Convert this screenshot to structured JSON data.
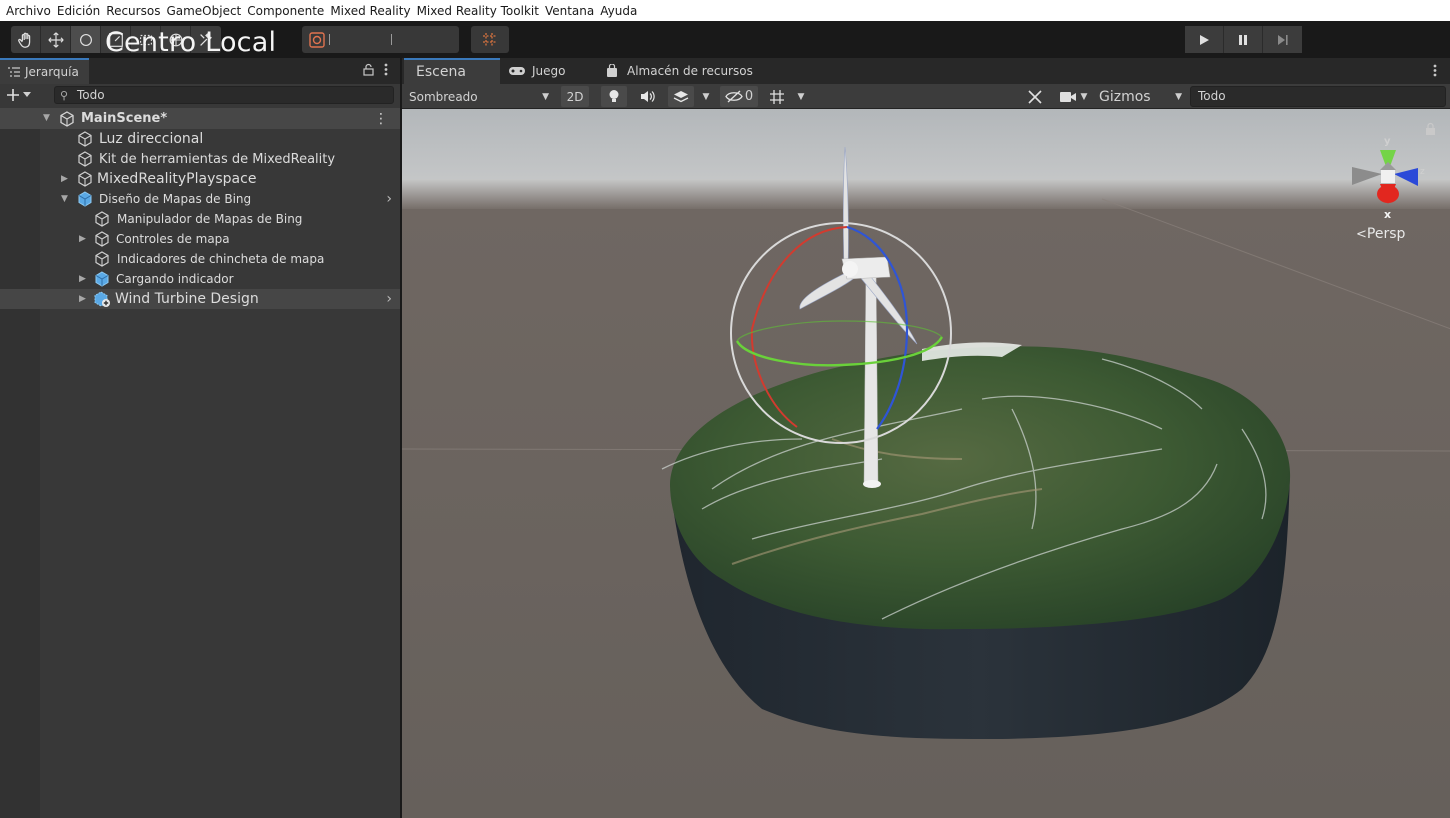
{
  "menu": [
    "Archivo",
    "Edición",
    "Recursos",
    "GameObject",
    "Componente",
    "Mixed Reality",
    "Mixed Reality Toolkit",
    "Ventana",
    "Ayuda"
  ],
  "toolbar": {
    "tools": [
      "hand-tool",
      "move-tool",
      "rotate-tool",
      "scale-tool",
      "rect-tool",
      "transform-tool",
      "custom-tool"
    ],
    "pivot_overlay": "Centro Local"
  },
  "hierarchy": {
    "tab_label": "Jerarquía",
    "search_value": "Todo",
    "scene_name": "MainScene*",
    "items": [
      {
        "label": "Luz direccional"
      },
      {
        "label": "Kit de herramientas de MixedReality"
      },
      {
        "label": "MixedRealityPlayspace"
      },
      {
        "label": "Diseño de Mapas de Bing"
      },
      {
        "label": "Manipulador de Mapas de Bing"
      },
      {
        "label": "Controles de mapa"
      },
      {
        "label": "Indicadores de chincheta de mapa"
      },
      {
        "label": "Cargando indicador"
      },
      {
        "label": "Wind Turbine Design"
      }
    ]
  },
  "scene": {
    "tabs": [
      {
        "label": "Escena"
      },
      {
        "label": "Juego"
      },
      {
        "label": "Almacén de recursos"
      }
    ],
    "shading": "Sombreado",
    "mode_2d": "2D",
    "hidden_count": "0",
    "gizmos": "Gizmos",
    "search_value": "Todo",
    "projection": "Persp",
    "axis_y": "y",
    "axis_x": "x",
    "axis_z": "z"
  },
  "colors": {
    "accent": "#3a79bb",
    "sky": "#b9bdc0",
    "ground": "#6a625d",
    "gizmo_x": "#e22a24",
    "gizmo_y": "#6ed23c",
    "gizmo_z": "#2b5fe6"
  }
}
